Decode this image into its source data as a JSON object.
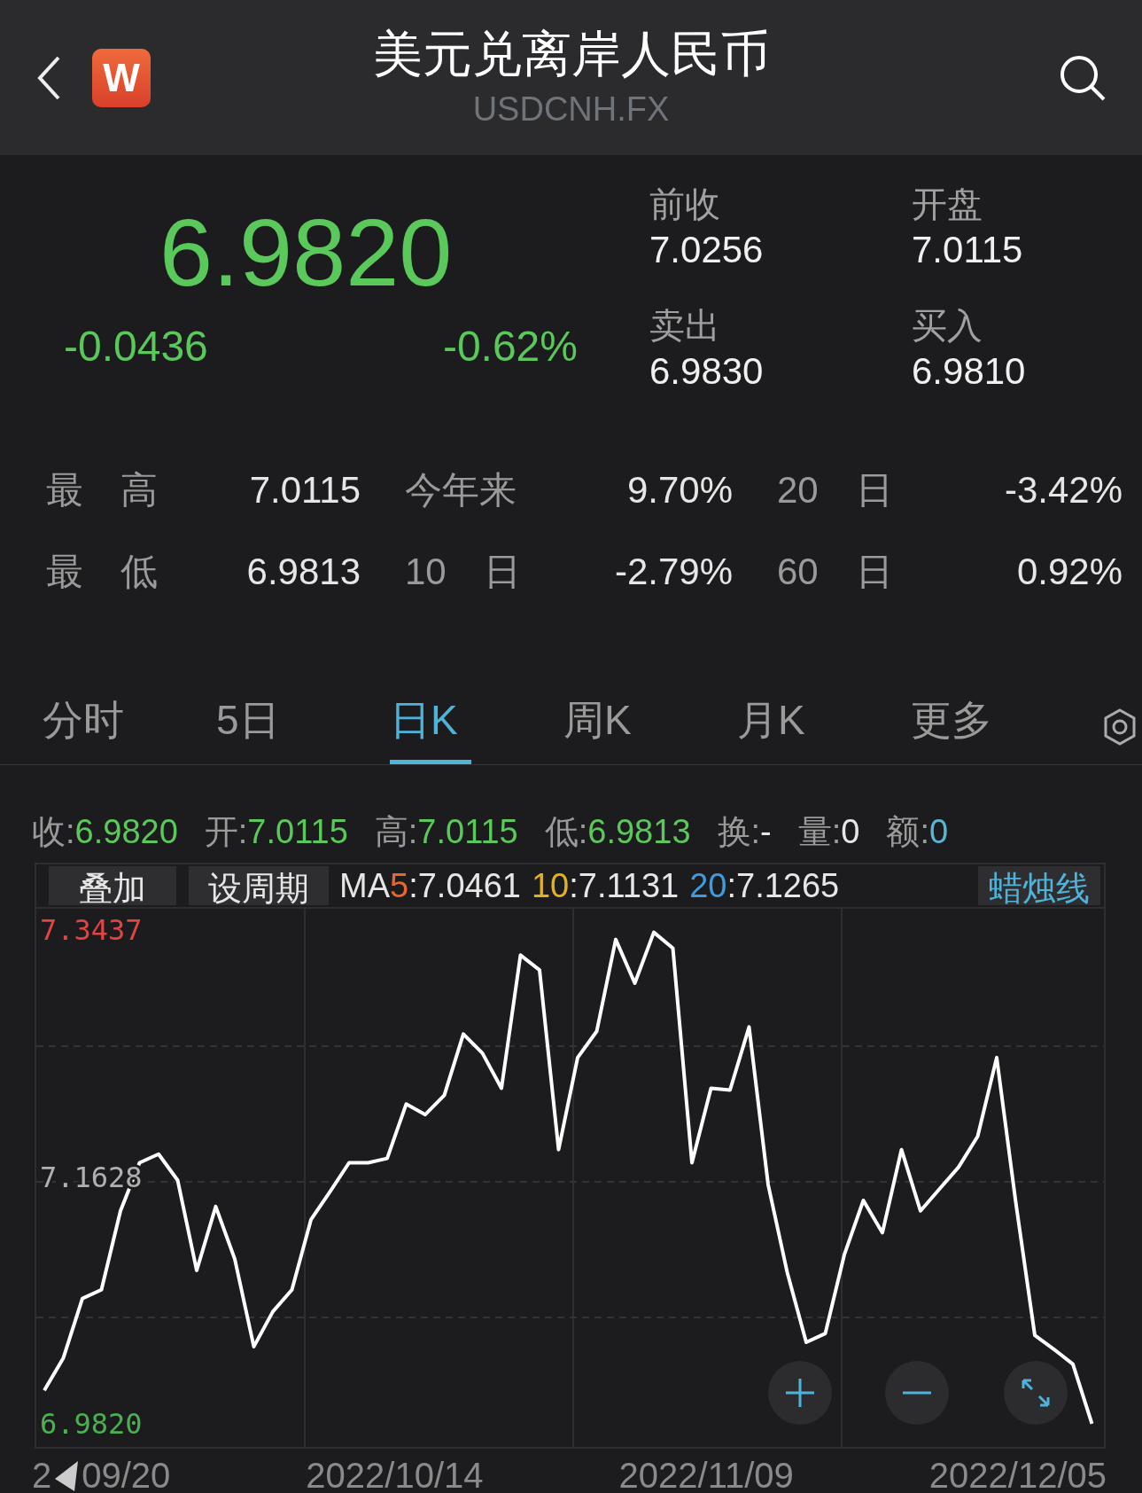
{
  "header": {
    "title": "美元兑离岸人民币",
    "subtitle": "USDCNH.FX",
    "app_badge": "W"
  },
  "quote": {
    "price": "6.9820",
    "change": "-0.0436",
    "change_pct": "-0.62%",
    "fields": [
      {
        "label": "前收",
        "value": "7.0256"
      },
      {
        "label": "开盘",
        "value": "7.0115"
      },
      {
        "label": "卖出",
        "value": "6.9830"
      },
      {
        "label": "买入",
        "value": "6.9810"
      }
    ]
  },
  "stats": [
    [
      {
        "label": "最　高",
        "value": "7.0115"
      },
      {
        "label": "今年来",
        "value": "9.70%"
      },
      {
        "label": "20　日",
        "value": "-3.42%"
      }
    ],
    [
      {
        "label": "最　低",
        "value": "6.9813"
      },
      {
        "label": "10　日",
        "value": "-2.79%"
      },
      {
        "label": "60　日",
        "value": "0.92%"
      }
    ]
  ],
  "tabs": [
    {
      "label": "分时",
      "selected": false
    },
    {
      "label": "5日",
      "selected": false
    },
    {
      "label": "日K",
      "selected": true
    },
    {
      "label": "周K",
      "selected": false
    },
    {
      "label": "月K",
      "selected": false
    },
    {
      "label": "更多",
      "selected": false
    }
  ],
  "ohlc": [
    {
      "label": "收:",
      "value": "6.9820",
      "color": "#5ac85a"
    },
    {
      "label": "开:",
      "value": "7.0115",
      "color": "#5ac85a"
    },
    {
      "label": "高:",
      "value": "7.0115",
      "color": "#5ac85a"
    },
    {
      "label": "低:",
      "value": "6.9813",
      "color": "#5ac85a"
    },
    {
      "label": "换:",
      "value": "-",
      "color": "#e6e6e6"
    },
    {
      "label": "量:",
      "value": "0",
      "color": "#e6e6e6"
    },
    {
      "label": "额:",
      "value": "0",
      "color": "#5ab4d2"
    }
  ],
  "chart_toolbar": {
    "overlay": "叠加",
    "period": "设周期",
    "ma_prefix": "MA",
    "ma": [
      {
        "period": "5",
        "value": ":7.0461",
        "color": "#e8672c"
      },
      {
        "period": "10",
        "value": ":7.1131",
        "color": "#e3b021"
      },
      {
        "period": "20",
        "value": ":7.1265",
        "color": "#3f9ae0"
      }
    ],
    "style": "蜡烛线"
  },
  "chart": {
    "chart_data": {
      "type": "line",
      "ylim": [
        6.965,
        7.392
      ],
      "yticks": [
        {
          "value": 6.982,
          "label": "6.9820"
        },
        {
          "value": 7.1628,
          "label": "7.1628"
        },
        {
          "value": 7.3437,
          "label": "7.3437"
        }
      ],
      "series": [
        {
          "color": "#ffffff",
          "values": [
            7.0064,
            7.0302,
            7.0738,
            7.0802,
            7.138,
            7.1733,
            7.1797,
            7.1605,
            7.0944,
            7.1412,
            7.1027,
            7.0385,
            7.0642,
            7.0802,
            7.1316,
            7.1521,
            7.1733,
            7.1733,
            7.1765,
            7.2163,
            7.2086,
            7.2228,
            7.2677,
            7.2536,
            7.2279,
            7.3255,
            7.3146,
            7.1829,
            7.2504,
            7.2696,
            7.337,
            7.3049,
            7.3422,
            7.3306,
            7.1733,
            7.2279,
            7.2266,
            7.2728,
            7.1573,
            7.0931,
            7.0417,
            7.0481,
            7.1059,
            7.1457,
            7.122,
            7.1829,
            7.138,
            7.1541,
            7.1701,
            7.1926,
            7.2504,
            7.1444,
            7.0468,
            7.0366,
            7.0257,
            6.982
          ]
        }
      ]
    },
    "x_label_fragment": "2",
    "x_labels": [
      "09/20",
      "2022/10/14",
      "2022/11/09",
      "2022/12/05"
    ]
  }
}
